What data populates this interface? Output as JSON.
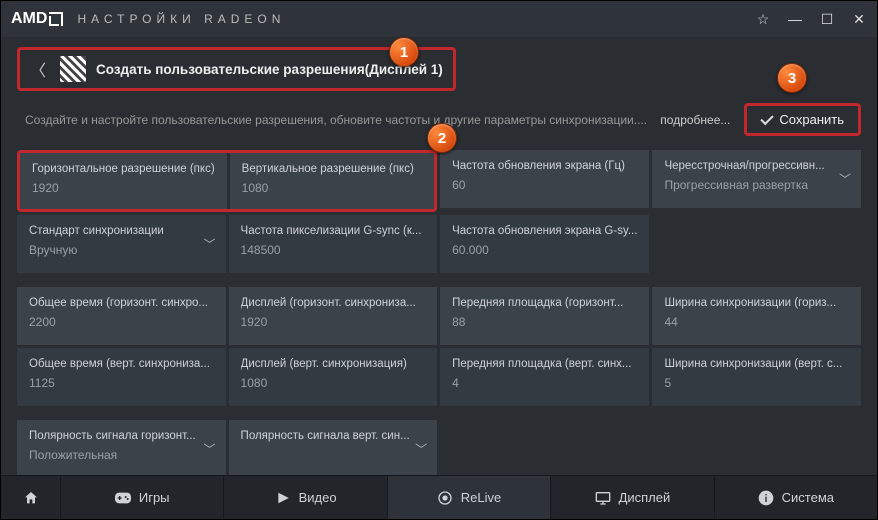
{
  "titlebar": {
    "logo": "AMD",
    "title": "НАСТРОЙКИ RADEON"
  },
  "breadcrumb": {
    "label": "Создать пользовательские разрешения(Дисплей 1)"
  },
  "subtitle": "Создайте и настройте пользовательские разрешения, обновите частоты и другие параметры синхронизации....",
  "actions": {
    "more": "подробнее...",
    "save": "Сохранить"
  },
  "cells": {
    "hres": {
      "label": "Горизонтальное разрешение (пкс)",
      "value": "1920"
    },
    "vres": {
      "label": "Вертикальное разрешение (пкс)",
      "value": "1080"
    },
    "refresh": {
      "label": "Частота обновления экрана (Гц)",
      "value": "60"
    },
    "scan": {
      "label": "Чересстрочная/прогрессивн...",
      "value": "Прогрессивная развертка"
    },
    "timing": {
      "label": "Стандарт синхронизации",
      "value": "Вручную"
    },
    "pixclk": {
      "label": "Частота пикселизации G-sync (к...",
      "value": "148500"
    },
    "gsync": {
      "label": "Частота обновления экрана G-sy...",
      "value": "60.000"
    },
    "htotal": {
      "label": "Общее время (горизонт. синхро...",
      "value": "2200"
    },
    "hdisp": {
      "label": "Дисплей (горизонт. синхрониза...",
      "value": "1920"
    },
    "hfp": {
      "label": "Передняя площадка (горизонт...",
      "value": "88"
    },
    "hsw": {
      "label": "Ширина синхронизации (гориз...",
      "value": "44"
    },
    "vtotal": {
      "label": "Общее время (верт. синхрониза...",
      "value": "1125"
    },
    "vdisp": {
      "label": "Дисплей (верт. синхронизация)",
      "value": "1080"
    },
    "vfp": {
      "label": "Передняя площадка (верт. синх...",
      "value": "4"
    },
    "vsw": {
      "label": "Ширина синхронизации (верт. с...",
      "value": "5"
    },
    "hpol": {
      "label": "Полярность сигнала горизонт...",
      "value": "Положительная"
    },
    "vpol": {
      "label": "Полярность сигнала верт. син...",
      "value": ""
    }
  },
  "nav": {
    "games": "Игры",
    "video": "Видео",
    "relive": "ReLive",
    "display": "Дисплей",
    "system": "Система"
  },
  "callouts": {
    "c1": "1",
    "c2": "2",
    "c3": "3"
  }
}
